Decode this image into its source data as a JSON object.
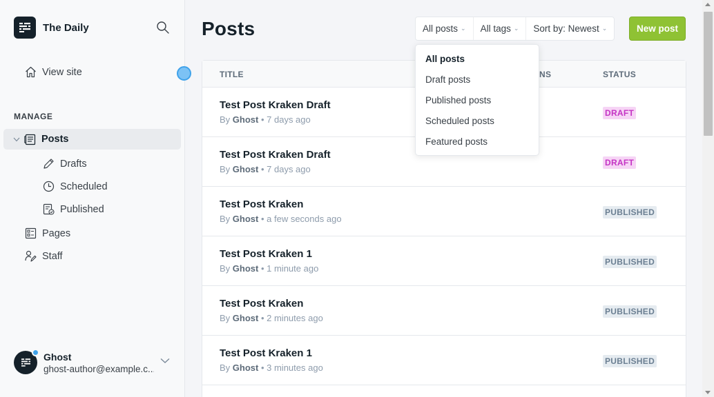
{
  "brand": {
    "name": "The Daily"
  },
  "sidebar": {
    "view_site": "View site",
    "manage_label": "MANAGE",
    "posts": "Posts",
    "subitems": [
      "Drafts",
      "Scheduled",
      "Published"
    ],
    "pages": "Pages",
    "staff": "Staff"
  },
  "user": {
    "name": "Ghost",
    "email": "ghost-author@example.c..."
  },
  "header": {
    "title": "Posts",
    "filters": {
      "type": "All posts",
      "tags": "All tags",
      "sort": "Sort by: Newest"
    },
    "new_post": "New post"
  },
  "table": {
    "columns": {
      "title": "TITLE",
      "partial": "NS",
      "status": "STATUS"
    },
    "rows": [
      {
        "title": "Test Post Kraken Draft",
        "by": "By",
        "author": "Ghost",
        "time": "7 days ago",
        "status": "DRAFT"
      },
      {
        "title": "Test Post Kraken Draft",
        "by": "By",
        "author": "Ghost",
        "time": "7 days ago",
        "status": "DRAFT"
      },
      {
        "title": "Test Post Kraken",
        "by": "By",
        "author": "Ghost",
        "time": "a few seconds ago",
        "status": "PUBLISHED"
      },
      {
        "title": "Test Post Kraken 1",
        "by": "By",
        "author": "Ghost",
        "time": "1 minute ago",
        "status": "PUBLISHED"
      },
      {
        "title": "Test Post Kraken",
        "by": "By",
        "author": "Ghost",
        "time": "2 minutes ago",
        "status": "PUBLISHED"
      },
      {
        "title": "Test Post Kraken 1",
        "by": "By",
        "author": "Ghost",
        "time": "3 minutes ago",
        "status": "PUBLISHED"
      }
    ]
  },
  "dropdown": {
    "items": [
      "All posts",
      "Draft posts",
      "Published posts",
      "Scheduled posts",
      "Featured posts"
    ],
    "selected": "All posts"
  },
  "colors": {
    "accent": "#8fc234",
    "draft_badge": "#f6d4f5",
    "published_badge": "#e5ebf0",
    "notification_dot": "#3fa2ea"
  },
  "icons": [
    "ghost-logo-icon",
    "search-icon",
    "home-icon",
    "chevron-down-icon",
    "posts-icon",
    "pencil-icon",
    "clock-icon",
    "published-icon",
    "pages-icon",
    "staff-icon"
  ]
}
